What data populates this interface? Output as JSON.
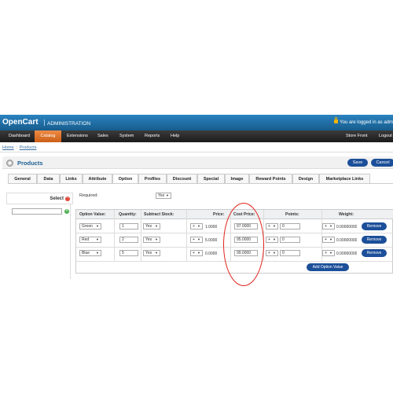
{
  "header": {
    "logo": "OpenCart",
    "subtitle": "ADMINISTRATION",
    "logged_in": "You are logged in as adm"
  },
  "menu": {
    "items": [
      {
        "label": "Dashboard"
      },
      {
        "label": "Catalog",
        "active": true
      },
      {
        "label": "Extensions"
      },
      {
        "label": "Sales"
      },
      {
        "label": "System"
      },
      {
        "label": "Reports"
      },
      {
        "label": "Help"
      }
    ],
    "right": [
      {
        "label": "Store Front"
      },
      {
        "label": "Logout"
      }
    ]
  },
  "breadcrumb": [
    "Home",
    "Products"
  ],
  "page": {
    "title": "Products",
    "save_label": "Save",
    "cancel_label": "Cancel"
  },
  "tabs": [
    {
      "label": "General"
    },
    {
      "label": "Data"
    },
    {
      "label": "Links"
    },
    {
      "label": "Attribute"
    },
    {
      "label": "Option",
      "active": true
    },
    {
      "label": "Profiles"
    },
    {
      "label": "Discount"
    },
    {
      "label": "Special"
    },
    {
      "label": "Image"
    },
    {
      "label": "Reward Points"
    },
    {
      "label": "Design"
    },
    {
      "label": "Marketplace Links"
    }
  ],
  "sidebar": {
    "select_label": "Select",
    "input_value": ""
  },
  "option": {
    "required_label": "Required:",
    "required_value": "Yes"
  },
  "table": {
    "headers": {
      "option_value": "Option Value:",
      "quantity": "Quantity:",
      "subtract": "Subtract Stock:",
      "price": "Price:",
      "cost_price": "Cost Price:",
      "points": "Points:",
      "weight": "Weight:"
    },
    "rows": [
      {
        "value": "Green",
        "qty": "1",
        "subtract": "Yes",
        "price_prefix": "+",
        "price": "1.0000",
        "cost": "97.0000",
        "points_prefix": "+",
        "points": "0",
        "weight_prefix": "+",
        "weight": "0.00000000"
      },
      {
        "value": "Red",
        "qty": "2",
        "subtract": "Yes",
        "price_prefix": "+",
        "price": "5.0000",
        "cost": "95.0000",
        "points_prefix": "+",
        "points": "0",
        "weight_prefix": "+",
        "weight": "0.00000000"
      },
      {
        "value": "Blue",
        "qty": "5",
        "subtract": "Yes",
        "price_prefix": "+",
        "price": "0.0000",
        "cost": "99.0000",
        "points_prefix": "+",
        "points": "0",
        "weight_prefix": "+",
        "weight": "0.00000000"
      }
    ],
    "remove_label": "Remove",
    "add_label": "Add Option Value"
  },
  "colors": {
    "header_blue": "#1d6fa5",
    "menu_dark": "#2b2b2b",
    "active_orange": "#e1722a",
    "button_blue": "#1c4f99",
    "highlight_red": "#e0231b"
  }
}
